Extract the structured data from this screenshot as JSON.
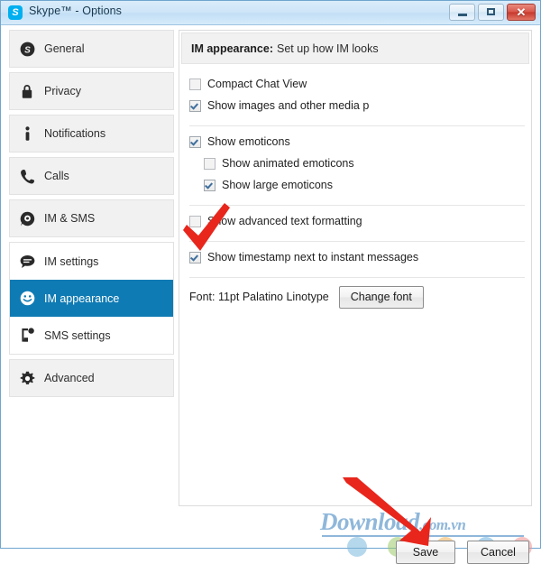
{
  "window": {
    "title": "Skype™ - Options",
    "icon": "skype-icon",
    "controls": {
      "minimize": "−",
      "maximize": "□",
      "close": "✕"
    }
  },
  "sidebar": {
    "groups": [
      {
        "items": [
          {
            "label": "General",
            "icon": "skype-icon",
            "glyph": "S",
            "selected": false
          }
        ]
      },
      {
        "items": [
          {
            "label": "Privacy",
            "icon": "lock-icon",
            "glyph": "lock",
            "selected": false
          }
        ]
      },
      {
        "items": [
          {
            "label": "Notifications",
            "icon": "info-icon",
            "glyph": "i",
            "selected": false
          }
        ]
      },
      {
        "items": [
          {
            "label": "Calls",
            "icon": "phone-icon",
            "glyph": "phone",
            "selected": false
          }
        ]
      },
      {
        "items": [
          {
            "label": "IM & SMS",
            "icon": "chat-gear-icon",
            "glyph": "gear-bubble",
            "selected": false
          }
        ]
      },
      {
        "items": [
          {
            "label": "IM settings",
            "icon": "speech-bubble-icon",
            "glyph": "bubble",
            "selected": false
          },
          {
            "label": "IM appearance",
            "icon": "smiley-icon",
            "glyph": "smiley",
            "selected": true
          },
          {
            "label": "SMS settings",
            "icon": "sms-phone-icon",
            "glyph": "sms",
            "selected": false
          }
        ]
      },
      {
        "items": [
          {
            "label": "Advanced",
            "icon": "gear-icon",
            "glyph": "gear",
            "selected": false
          }
        ]
      }
    ]
  },
  "main": {
    "header_strong": "IM appearance:",
    "header_rest": "Set up how IM looks",
    "options": [
      {
        "label": "Compact Chat View",
        "checked": false,
        "indent": false
      },
      {
        "label": "Show images and other media p",
        "checked": true,
        "indent": false
      },
      {
        "label": "Show emoticons",
        "checked": true,
        "indent": false
      },
      {
        "label": "Show animated emoticons",
        "checked": false,
        "indent": true
      },
      {
        "label": "Show large emoticons",
        "checked": true,
        "indent": true
      },
      {
        "label": "Show advanced text formatting",
        "checked": false,
        "indent": false
      },
      {
        "label": "Show timestamp next to instant messages",
        "checked": true,
        "indent": false
      }
    ],
    "font": {
      "label": "Font: 11pt Palatino Linotype",
      "button": "Change font"
    }
  },
  "footer": {
    "save": "Save",
    "cancel": "Cancel"
  },
  "watermark": {
    "main": "Download",
    "suffix": ".com.vn"
  },
  "colors": {
    "accent_selected": "#0f7bb4",
    "titlebar": "#cfe6f8",
    "close_button": "#c6372b",
    "annotation_red": "#e8261c",
    "watermark_blue": "#8fb7da",
    "sidebar_group": "#f1f1f1"
  }
}
